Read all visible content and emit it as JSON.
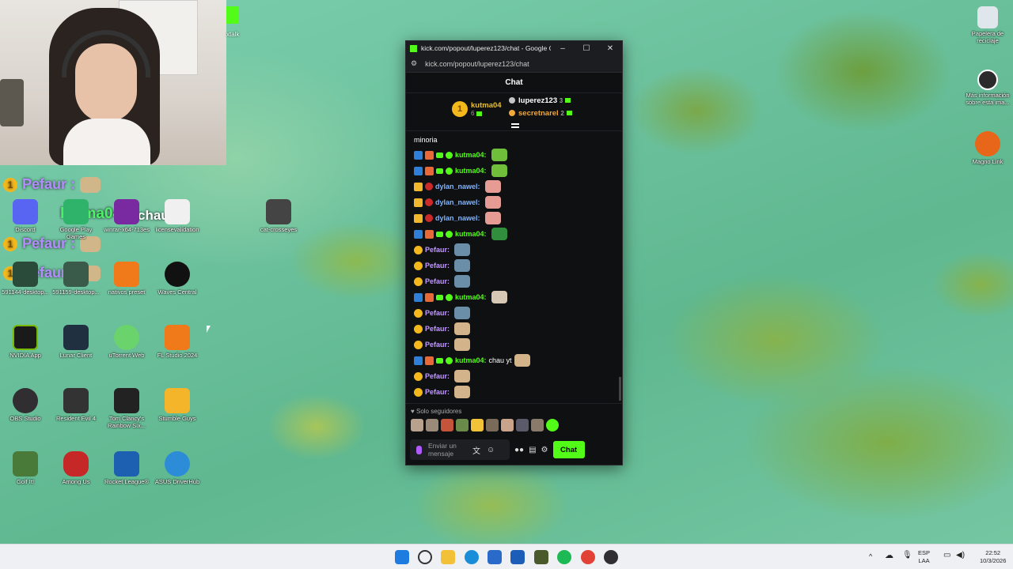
{
  "overlay": {
    "lines": [
      "Pefaur :",
      "Pefaur :",
      "Pefaur :"
    ],
    "highlight_user": "kutma04 :",
    "highlight_text": "chau yt",
    "kick_label": "xtalk"
  },
  "desktop_icons": [
    {
      "label": "Discord",
      "icon": "discord-icon",
      "color": "#5865f2"
    },
    {
      "label": "Google Play Games",
      "icon": "play-games-icon",
      "color": "#2fb36a"
    },
    {
      "label": "winrar-x64-713es",
      "icon": "winrar-icon",
      "color": "#7a2aa0"
    },
    {
      "label": "licensevalidation",
      "icon": "document-icon",
      "color": "#f0f0f0"
    },
    {
      "label": "cat-crosseyes",
      "icon": "image-icon",
      "color": "#444"
    },
    {
      "label": "591144-desktop...",
      "icon": "image-icon",
      "color": "#2a4a3a"
    },
    {
      "label": "591159-desktop...",
      "icon": "image-icon",
      "color": "#3a5a4a"
    },
    {
      "label": "nativos preset",
      "icon": "fl-studio-icon",
      "color": "#f07a1a"
    },
    {
      "label": "Waves Central",
      "icon": "waves-icon",
      "color": "#111"
    },
    {
      "label": "NVIDIA App",
      "icon": "nvidia-icon",
      "color": "#1a1a1a"
    },
    {
      "label": "Lunar Client",
      "icon": "lunar-icon",
      "color": "#203040"
    },
    {
      "label": "uTorrent Web",
      "icon": "utorrent-icon",
      "color": "#6bd36b"
    },
    {
      "label": "FL Studio 2024",
      "icon": "fl-studio-icon",
      "color": "#f07a1a"
    },
    {
      "label": "OBS Studio",
      "icon": "obs-icon",
      "color": "#302e31"
    },
    {
      "label": "Resident Evil 4",
      "icon": "re4-icon",
      "color": "#333"
    },
    {
      "label": "Tom Clancy's Rainbow Six...",
      "icon": "r6-icon",
      "color": "#222"
    },
    {
      "label": "Stumble Guys",
      "icon": "stumble-icon",
      "color": "#f5b52a"
    },
    {
      "label": "Golf It!",
      "icon": "golf-icon",
      "color": "#4a7a3a"
    },
    {
      "label": "Among Us",
      "icon": "amongus-icon",
      "color": "#c62828"
    },
    {
      "label": "Rocket League®",
      "icon": "rocket-league-icon",
      "color": "#1d5fb0"
    },
    {
      "label": "ASUS DriverHub",
      "icon": "asus-icon",
      "color": "#2d8cd8"
    }
  ],
  "right_icons": [
    {
      "label": "Papelera de reciclaje",
      "icon": "recycle-bin-icon",
      "color": "#dfe6ec"
    },
    {
      "label": "Más información sobre esta ima...",
      "icon": "info-icon",
      "color": "#2b2b2b"
    },
    {
      "label": "Magno Link",
      "icon": "magno-icon",
      "color": "#e8661a"
    }
  ],
  "window": {
    "title": "kick.com/popout/luperez123/chat - Google C...",
    "url": "kick.com/popout/luperez123/chat",
    "chat_header": "Chat",
    "top_gifters": [
      {
        "name": "kutma04",
        "count": "6"
      },
      {
        "name": "luperez123",
        "count": "3"
      },
      {
        "name": "secretnarel",
        "count": "2"
      }
    ],
    "pinned": "minoria",
    "messages": [
      {
        "user": "kutma04:",
        "text": "",
        "type": "k"
      },
      {
        "user": "kutma04:",
        "text": "",
        "type": "k"
      },
      {
        "user": "dylan_nawel:",
        "text": "",
        "type": "d"
      },
      {
        "user": "dylan_nawel:",
        "text": "",
        "type": "d"
      },
      {
        "user": "dylan_nawel:",
        "text": "",
        "type": "d"
      },
      {
        "user": "kutma04:",
        "text": "",
        "type": "k"
      },
      {
        "user": "Pefaur:",
        "text": "",
        "type": "p"
      },
      {
        "user": "Pefaur:",
        "text": "",
        "type": "p"
      },
      {
        "user": "Pefaur:",
        "text": "",
        "type": "p"
      },
      {
        "user": "kutma04:",
        "text": "",
        "type": "k"
      },
      {
        "user": "Pefaur:",
        "text": "",
        "type": "p"
      },
      {
        "user": "Pefaur:",
        "text": "",
        "type": "p"
      },
      {
        "user": "Pefaur:",
        "text": "",
        "type": "p"
      },
      {
        "user": "kutma04:",
        "text": "chau yt",
        "type": "k"
      },
      {
        "user": "Pefaur:",
        "text": "",
        "type": "p"
      },
      {
        "user": "Pefaur:",
        "text": "",
        "type": "p"
      }
    ],
    "followers_only": "Solo seguidores",
    "input_placeholder": "Enviar un mensaje",
    "chat_button": "Chat"
  },
  "taskbar": {
    "lang": "ESP",
    "region": "LAA",
    "time": "22:52",
    "date": "10/3/2026"
  }
}
